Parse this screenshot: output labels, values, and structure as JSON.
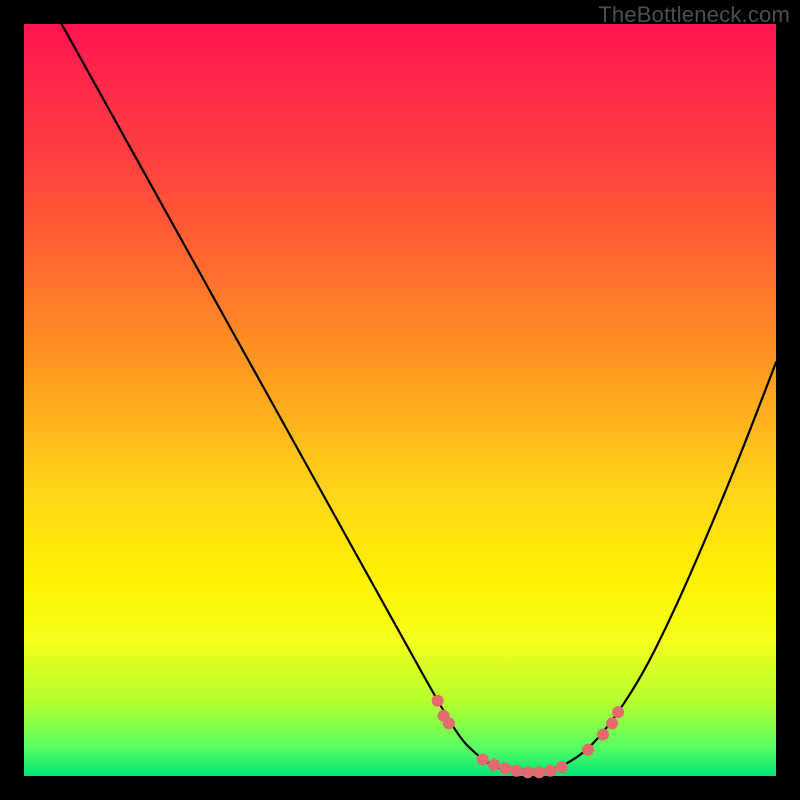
{
  "watermark": "TheBottleneck.com",
  "colors": {
    "background": "#000000",
    "gradient_top": "#ff1450",
    "gradient_mid": "#fff200",
    "gradient_bottom": "#00e676",
    "curve": "#000000",
    "dots": "#e46a6e"
  },
  "chart_data": {
    "type": "line",
    "title": "",
    "xlabel": "",
    "ylabel": "",
    "xlim": [
      0,
      100
    ],
    "ylim": [
      0,
      100
    ],
    "grid": false,
    "series": [
      {
        "name": "bottleneck-curve",
        "x": [
          5,
          10,
          15,
          20,
          25,
          30,
          35,
          40,
          45,
          50,
          55,
          58,
          60,
          62,
          64,
          66,
          68,
          70,
          72,
          75,
          78,
          82,
          86,
          90,
          95,
          100
        ],
        "values": [
          100,
          91,
          82,
          73,
          64,
          55,
          46,
          37,
          28,
          19,
          10,
          5,
          3,
          1.5,
          0.8,
          0.5,
          0.5,
          0.8,
          1.5,
          3.5,
          7,
          13,
          21,
          30,
          42,
          55
        ]
      }
    ],
    "highlight_points": {
      "name": "sweet-spot-dots",
      "x": [
        55,
        55.8,
        56.5,
        61,
        62.5,
        64,
        65.5,
        67,
        68.5,
        70,
        71.5,
        75,
        77,
        78.2,
        79
      ],
      "values": [
        10,
        8,
        7,
        2.2,
        1.5,
        1,
        0.7,
        0.5,
        0.5,
        0.7,
        1.2,
        3.5,
        5.5,
        7,
        8.5
      ]
    }
  }
}
